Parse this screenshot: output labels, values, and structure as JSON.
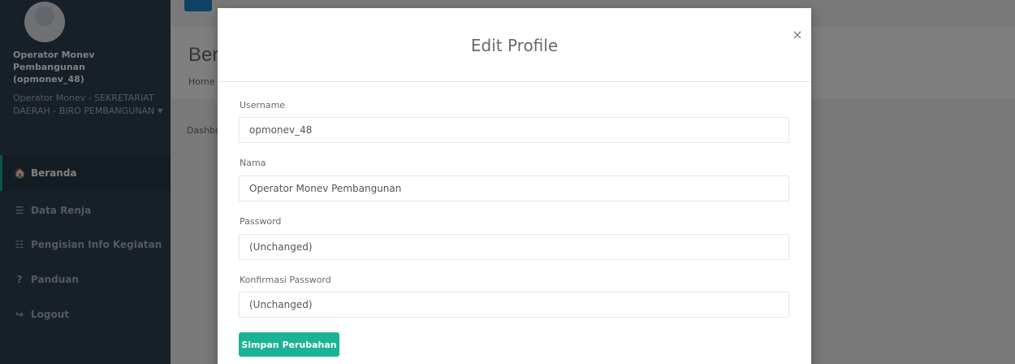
{
  "sidebar": {
    "profile_name": "Operator Monev Pembangunan (opmonev_48)",
    "profile_role": "Operator Monev - SEKRETARIAT DAERAH - BIRO PEMBANGUNAN",
    "items": [
      {
        "label": "Beranda",
        "icon": "home-icon",
        "glyph": "🏠"
      },
      {
        "label": "Data Renja",
        "icon": "database-icon",
        "glyph": "☰"
      },
      {
        "label": "Pengisian Info Kegiatan",
        "icon": "list-icon",
        "glyph": "☷"
      },
      {
        "label": "Panduan",
        "icon": "question-icon",
        "glyph": "?"
      },
      {
        "label": "Logout",
        "icon": "sign-out-icon",
        "glyph": "↪"
      }
    ]
  },
  "page": {
    "heading_title": "Ber",
    "heading_breadcrumb": "Home",
    "content_breadcrumb": "Dashbo"
  },
  "modal": {
    "title": "Edit Profile",
    "close_glyph": "×",
    "username_label": "Username",
    "username_value": "opmonev_48",
    "nama_label": "Nama",
    "nama_value": "Operator Monev Pembangunan",
    "password_label": "Password",
    "password_placeholder": "(Unchanged)",
    "confirm_label": "Konfirmasi Password",
    "confirm_placeholder": "(Unchanged)",
    "save_label": "Simpan Perubahan"
  },
  "colors": {
    "sidebar_bg": "#2f4050",
    "accent": "#1ab394",
    "primary_btn": "#1c84c6"
  }
}
